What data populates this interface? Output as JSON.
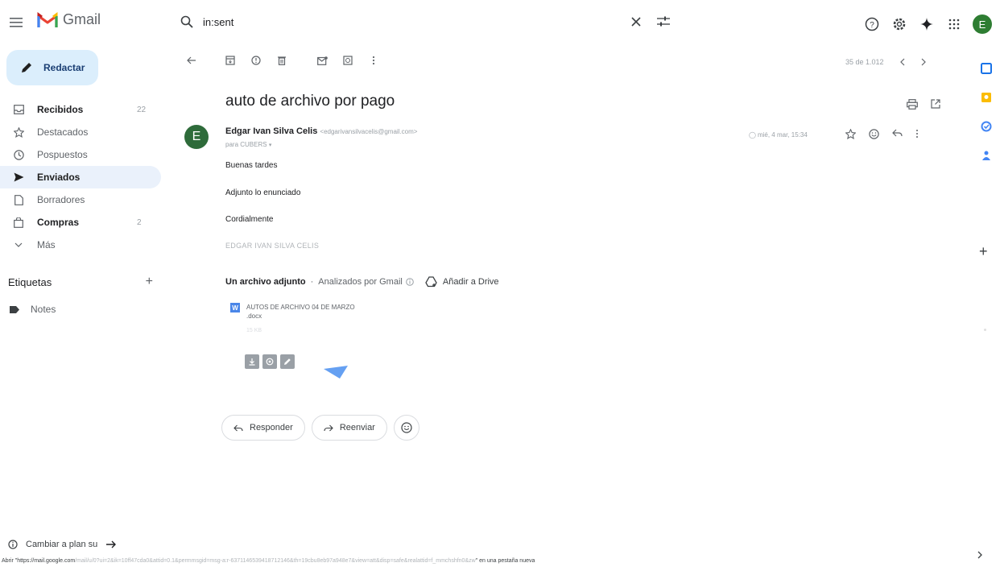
{
  "header": {
    "app_name": "Gmail",
    "search_query": "in:sent",
    "account_initial": "E"
  },
  "sidebar": {
    "compose_label": "Redactar",
    "items": [
      {
        "label": "Recibidos",
        "count": "22",
        "icon": "inbox-icon"
      },
      {
        "label": "Destacados",
        "count": "",
        "icon": "star-icon"
      },
      {
        "label": "Pospuestos",
        "count": "",
        "icon": "clock-icon"
      },
      {
        "label": "Enviados",
        "count": "",
        "icon": "send-icon"
      },
      {
        "label": "Borradores",
        "count": "",
        "icon": "draft-icon"
      },
      {
        "label": "Compras",
        "count": "2",
        "icon": "shopping-icon"
      },
      {
        "label": "Más",
        "count": "",
        "icon": "chevron-down-icon"
      }
    ],
    "labels_title": "Etiquetas",
    "labels": [
      "Notes"
    ],
    "plan_text": "Cambiar a plan su"
  },
  "toolbar": {
    "pager": "35 de 1.012"
  },
  "message": {
    "subject": "auto de archivo por pago",
    "sender_initial": "E",
    "sender_name": "Edgar Ivan Silva Celis",
    "sender_email": "<edgarivansilvacelis@gmail.com>",
    "to": "para CUBERS",
    "date": "mié, 4 mar, 15:34",
    "body": [
      "Buenas tardes",
      "Adjunto lo enunciado",
      "Cordialmente"
    ],
    "signature": "EDGAR IVAN SILVA CELIS"
  },
  "attachments": {
    "count_label": "Un archivo adjunto",
    "scanned_label": "Analizados por Gmail",
    "add_drive_label": "Añadir a Drive",
    "file_name": "AUTOS DE ARCHIVO 04 DE MARZO .docx",
    "file_size": "15 KB",
    "file_type_letter": "W"
  },
  "reply": {
    "reply_label": "Responder",
    "forward_label": "Reenviar"
  },
  "status_bar": {
    "prefix": "Abrir \"https://mail.google.com",
    "url_rest": "/mail/u/0?ui=2&ik=10ff47cda0&attid=0.1&permmsgid=msg-a:r-6371146539418712146&th=19cbu8eb97a948e7&view=att&disp=safe&realattid=f_mmchshfn0&zw",
    "suffix": "\" en una pestaña nueva"
  },
  "colors": {
    "compose_bg": "#dbeefc",
    "active_nav_bg": "#eaf1fb",
    "avatar_green": "#2e7d32",
    "gmail_red": "#ea4335"
  }
}
